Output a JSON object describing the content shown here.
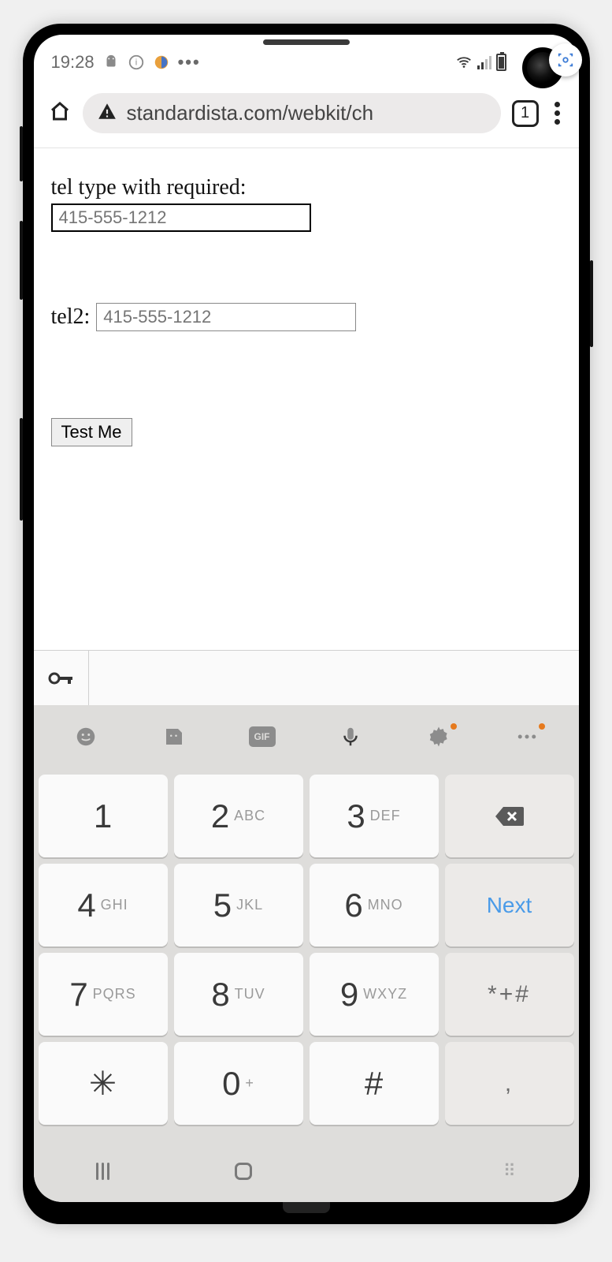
{
  "status": {
    "time": "19:28"
  },
  "browser": {
    "url": "standardista.com/webkit/ch",
    "tab_count": "1"
  },
  "page": {
    "label1": "tel type with required:",
    "input1_placeholder": "415-555-1212",
    "label2": "tel2:",
    "input2_placeholder": "415-555-1212",
    "submit_label": "Test Me"
  },
  "keyboard": {
    "gif_label": "GIF",
    "next_label": "Next",
    "rows": [
      [
        {
          "num": "1",
          "sub": ""
        },
        {
          "num": "2",
          "sub": "ABC"
        },
        {
          "num": "3",
          "sub": "DEF"
        },
        {
          "backspace": true
        }
      ],
      [
        {
          "num": "4",
          "sub": "GHI"
        },
        {
          "num": "5",
          "sub": "JKL"
        },
        {
          "num": "6",
          "sub": "MNO"
        },
        {
          "next": true
        }
      ],
      [
        {
          "num": "7",
          "sub": "PQRS"
        },
        {
          "num": "8",
          "sub": "TUV"
        },
        {
          "num": "9",
          "sub": "WXYZ"
        },
        {
          "sym": "*+#"
        }
      ],
      [
        {
          "sym_big": "✳"
        },
        {
          "num": "0",
          "sub": "+"
        },
        {
          "sym_big": "#"
        },
        {
          "sym": ","
        }
      ]
    ]
  }
}
